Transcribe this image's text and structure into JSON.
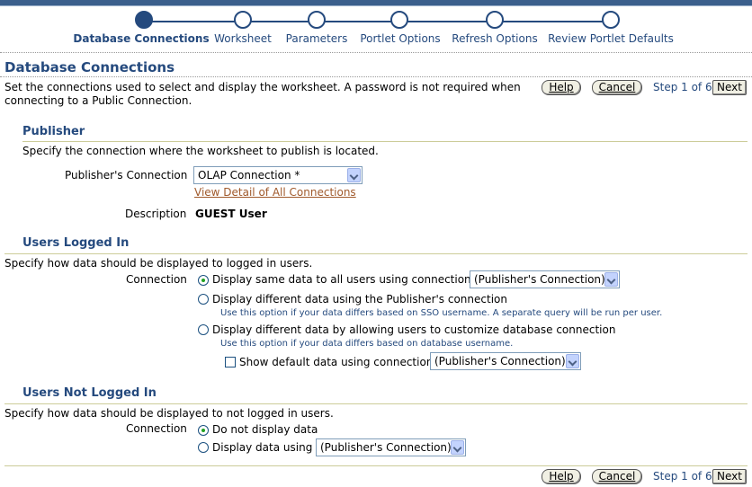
{
  "train": {
    "steps": [
      {
        "label": "Database Connections",
        "active": true
      },
      {
        "label": "Worksheet",
        "active": false
      },
      {
        "label": "Parameters",
        "active": false
      },
      {
        "label": "Portlet Options",
        "active": false
      },
      {
        "label": "Refresh Options",
        "active": false
      },
      {
        "label": "Review Portlet Defaults",
        "active": false
      }
    ]
  },
  "page": {
    "title": "Database Connections",
    "description_line1": "Set the connections used to select and display the worksheet. A password is not required when",
    "description_line2": "connecting to a Public Connection."
  },
  "nav": {
    "help_label": "Help",
    "cancel_label": "Cancel",
    "step_text": "Step 1 of 6",
    "next_label": "Next"
  },
  "publisher": {
    "title": "Publisher",
    "instruction": "Specify the connection where the worksheet to publish is located.",
    "connection_label": "Publisher's Connection",
    "connection_value": "OLAP Connection *",
    "view_detail_link": "View Detail of All Connections",
    "description_label": "Description",
    "description_value": "GUEST User"
  },
  "logged_in": {
    "title": "Users Logged In",
    "instruction": "Specify how data should be displayed to logged in users.",
    "connection_label": "Connection",
    "option1_label": "Display same data to all users using connection",
    "option1_select": "(Publisher's Connection)",
    "option2_label": "Display different data using the Publisher's connection",
    "option2_hint": "Use this option if your data differs based on SSO username. A separate query will be run per user.",
    "option3_label": "Display different data by allowing users to customize database connection",
    "option3_hint": "Use this option if your data differs based on database username.",
    "checkbox_label": "Show default data using connection",
    "checkbox_select": "(Publisher's Connection)"
  },
  "not_logged_in": {
    "title": "Users Not Logged In",
    "instruction": "Specify how data should be displayed to not logged in users.",
    "connection_label": "Connection",
    "option1_label": "Do not display data",
    "option2_label": "Display data using",
    "option2_select": "(Publisher's Connection)"
  }
}
